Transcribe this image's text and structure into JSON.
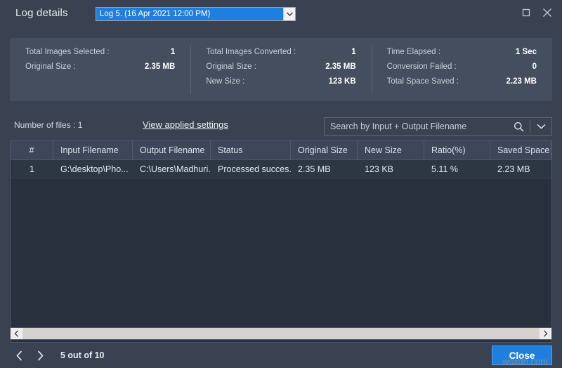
{
  "window": {
    "title": "Log details",
    "maximize_icon": "maximize-icon",
    "close_icon": "close-icon"
  },
  "log_selector": {
    "selected": "Log 5. (16 Apr 2021 12:00 PM)",
    "caret_icon": "chevron-down-icon"
  },
  "stats": {
    "columns": [
      {
        "rows": [
          {
            "label": "Total Images Selected :",
            "value": "1"
          },
          {
            "label": "Original Size :",
            "value": "2.35 MB"
          }
        ]
      },
      {
        "rows": [
          {
            "label": "Total Images Converted :",
            "value": "1"
          },
          {
            "label": "Original Size :",
            "value": "2.35 MB"
          },
          {
            "label": "New Size :",
            "value": "123 KB"
          }
        ]
      },
      {
        "rows": [
          {
            "label": "Time Elapsed :",
            "value": "1 Sec"
          },
          {
            "label": "Conversion Failed :",
            "value": "0"
          },
          {
            "label": "Total Space Saved :",
            "value": "2.23 MB"
          }
        ]
      }
    ]
  },
  "toolbar": {
    "files_count": "Number of files : 1",
    "applied_settings_link": "View applied settings",
    "search_placeholder": "Search by Input + Output Filename",
    "search_value": "",
    "search_icon": "search-icon",
    "search_caret_icon": "chevron-down-icon"
  },
  "table": {
    "headers": [
      "#",
      "Input Filename",
      "Output Filename",
      "Status",
      "Original Size",
      "New Size",
      "Ratio(%)",
      "Saved Space"
    ],
    "rows": [
      {
        "index": "1",
        "input_filename": "G:\\desktop\\Pho...",
        "output_filename": "C:\\Users\\Madhuri...",
        "status": "Processed succes...",
        "original_size": "2.35 MB",
        "new_size": "123 KB",
        "ratio": "5.11 %",
        "saved_space": "2.23 MB"
      }
    ]
  },
  "scrollbar": {
    "left_arrow_icon": "chevron-left-icon",
    "right_arrow_icon": "chevron-right-icon"
  },
  "footer": {
    "prev_icon": "chevron-left-icon",
    "next_icon": "chevron-right-icon",
    "page_label": "5 out of 10",
    "close_label": "Close",
    "watermark": "wsxdn.com"
  },
  "colors": {
    "window_bg": "#3a4251",
    "panel_bg": "#454e5e",
    "table_bg": "#28313d",
    "header_bg": "#3e4759",
    "accent": "#1e7fe0",
    "text": "#e9edf3"
  }
}
